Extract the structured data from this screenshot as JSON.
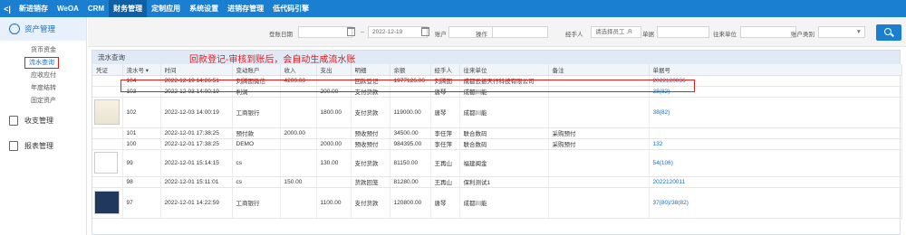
{
  "nav": {
    "back": "<|",
    "items": [
      "新进销存",
      "WeOA",
      "CRM",
      "财务管理",
      "定制应用",
      "系统设置",
      "进销存管理",
      "低代码引擎"
    ],
    "active": "财务管理",
    "accent": "#1a7fd1"
  },
  "sidebar": {
    "section": "资产管理",
    "subitems": [
      "货币资金",
      "流水查询",
      "应收应付",
      "年度结转",
      "固定资产"
    ],
    "active_sub": "流水查询",
    "groups": [
      "收支管理",
      "报表管理"
    ]
  },
  "filter": {
    "date_label": "登账日期",
    "date_start": "",
    "date_sep": "--",
    "date_end": "2022-12-19",
    "account_label": "账户",
    "op_label": "操作",
    "handler_label": "经手人",
    "handler_placeholder": "请选择员工 ,R",
    "doc_label": "单据",
    "partner_label": "往来单位",
    "acct_type_label": "账户类别"
  },
  "panel": {
    "title": "流水查询",
    "annotation": "回款登记-审核到账后，会自动生成流水账"
  },
  "table": {
    "columns": [
      "凭证",
      "流水号 ▾",
      "时间",
      "变动账户",
      "收入",
      "支出",
      "明细",
      "余额",
      "经手人",
      "往来单位",
      "备注",
      "单据号"
    ],
    "rows": [
      {
        "thumb": "",
        "no": "104",
        "time": "2022-12-19 14:26:51",
        "account": "刘腾图微信",
        "income": "4200.00",
        "expense": "",
        "detail": "回款登记",
        "balance": "1977126.00",
        "handler": "刘腾图",
        "partner": "成都云振天行科技有限公司",
        "remark": "",
        "doc": "2022120036"
      },
      {
        "thumb": "",
        "no": "103",
        "time": "2022-12-03 14:00:19",
        "account": "利润",
        "income": "",
        "expense": "200.00",
        "detail": "支付货款",
        "balance": "",
        "handler": "唐琴",
        "partner": "成都川能",
        "remark": "",
        "doc": "38(82)"
      },
      {
        "thumb": "receipt",
        "no": "102",
        "time": "2022-12-03 14:00:19",
        "account": "工商银行",
        "income": "",
        "expense": "1800.00",
        "detail": "支付货款",
        "balance": "119000.00",
        "handler": "唐琴",
        "partner": "成都川能",
        "remark": "",
        "doc": "38(82)"
      },
      {
        "thumb": "",
        "no": "101",
        "time": "2022-12-01 17:38:25",
        "account": "预付款",
        "income": "2000.00",
        "expense": "",
        "detail": "预收预付",
        "balance": "34500.00",
        "handler": "李任萍",
        "partner": "联合数码",
        "remark": "采购预付",
        "doc": ""
      },
      {
        "thumb": "",
        "no": "100",
        "time": "2022-12-01 17:38:25",
        "account": "DEMO",
        "income": "",
        "expense": "2000.00",
        "detail": "预收预付",
        "balance": "984395.00",
        "handler": "李任萍",
        "partner": "联合数码",
        "remark": "采购预付",
        "doc": "132"
      },
      {
        "thumb": "broken",
        "no": "99",
        "time": "2022-12-01 15:14:15",
        "account": "cs",
        "income": "",
        "expense": "130.00",
        "detail": "支付货款",
        "balance": "81150.00",
        "handler": "王再山",
        "partner": "福建闽金",
        "remark": "",
        "doc": "54(106)"
      },
      {
        "thumb": "",
        "no": "98",
        "time": "2022-12-01 15:11:01",
        "account": "cs",
        "income": "150.00",
        "expense": "",
        "detail": "货款回笼",
        "balance": "81280.00",
        "handler": "王再山",
        "partner": "保利测试1",
        "remark": "",
        "doc": "2022120011"
      },
      {
        "thumb": "photo",
        "no": "97",
        "time": "2022-12-01 14:22:59",
        "account": "工商银行",
        "income": "",
        "expense": "1100.00",
        "detail": "支付货款",
        "balance": "120800.00",
        "handler": "唐琴",
        "partner": "成都川能",
        "remark": "",
        "doc": "37(80)/38(82)"
      }
    ]
  }
}
